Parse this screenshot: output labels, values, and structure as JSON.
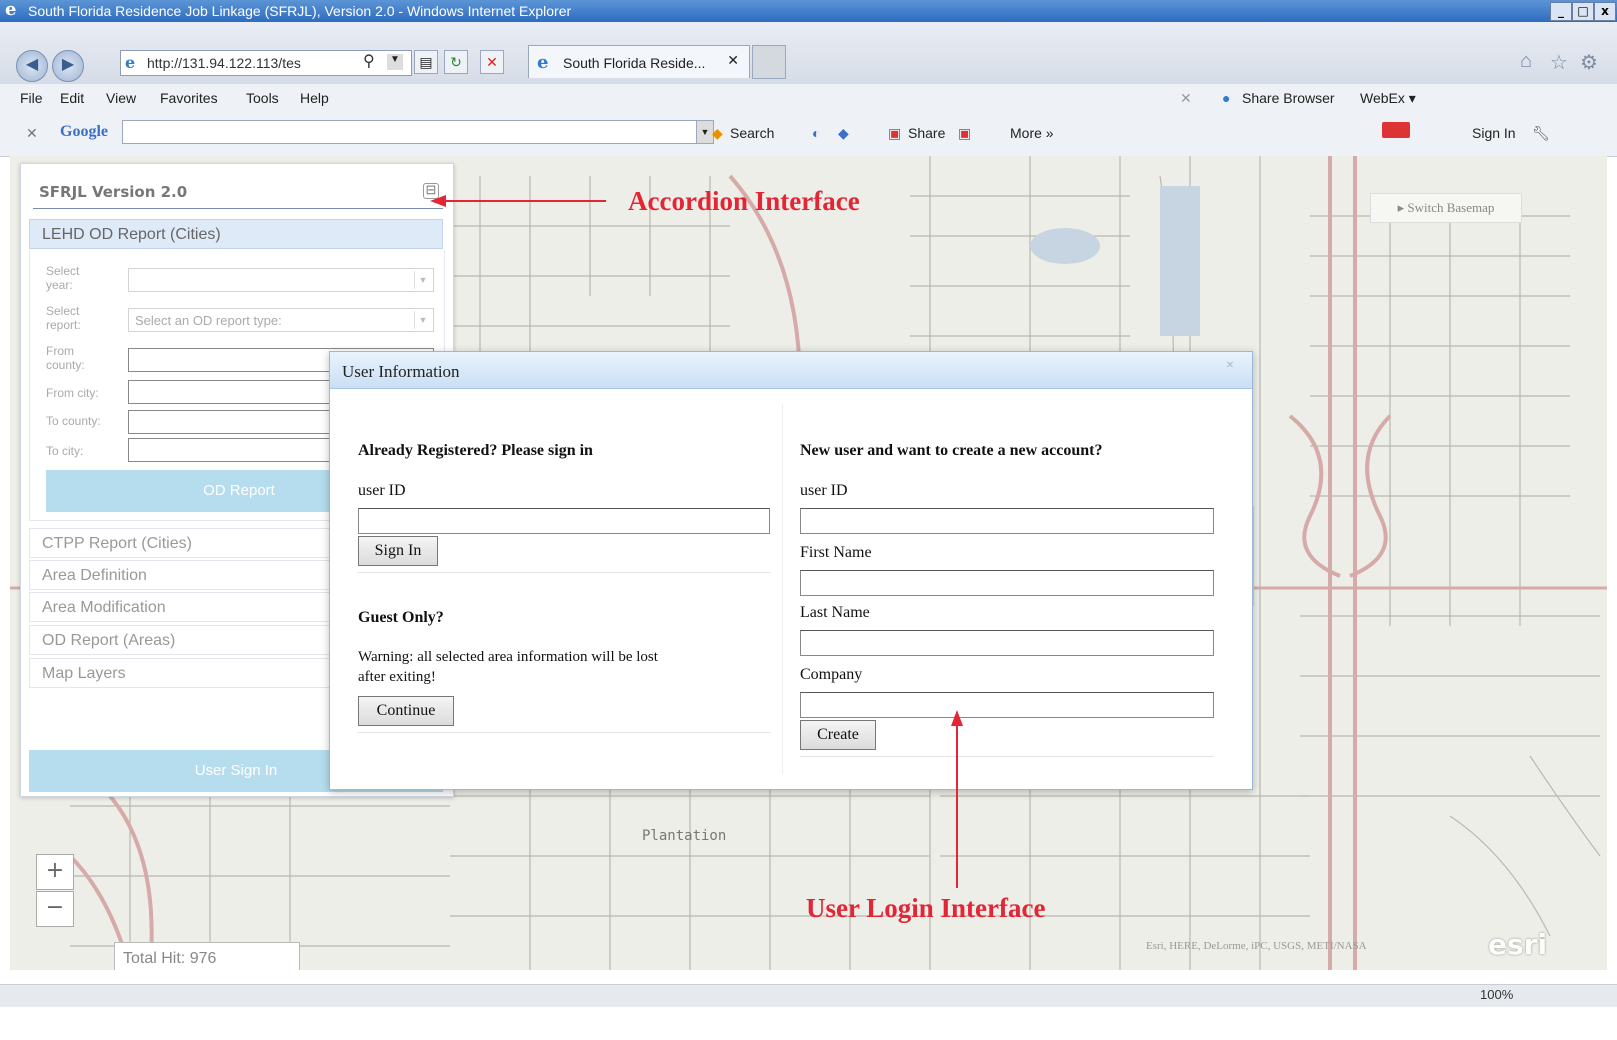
{
  "window": {
    "title": "South Florida Residence Job Linkage (SFRJL), Version 2.0 - Windows Internet Explorer",
    "minimize": "_",
    "maximize": "□",
    "close": "x"
  },
  "browser": {
    "address": "http://131.94.122.113/tes",
    "tab_title": "South Florida Reside...",
    "menu": [
      "File",
      "Edit",
      "View",
      "Favorites",
      "Tools",
      "Help"
    ],
    "share_browser": "Share Browser",
    "webex": "WebEx ▾",
    "google_logo": "Google",
    "search_label": "Search",
    "share_label": "Share",
    "more_label": "More »",
    "signin_label": "Sign In",
    "zoom_level": "100%"
  },
  "map": {
    "switch_basemap": "▸ Switch Basemap",
    "zoom_in": "+",
    "zoom_out": "−",
    "total_hit": "Total Hit: 976",
    "place_label": "Plantation",
    "attribution": "Esri, HERE, DeLorme, iPC, USGS, METI/NASA",
    "logo": "esri"
  },
  "panel": {
    "title": "SFRJL Version 2.0",
    "collapse_icon": "⊟",
    "sections": [
      "LEHD OD Report (Cities)",
      "CTPP Report (Cities)",
      "Area Definition",
      "Area Modification",
      "OD Report (Areas)",
      "Map Layers"
    ],
    "form": {
      "select_year_label": "Select year:",
      "select_report_label": "Select report:",
      "report_placeholder": "Select an OD report type:",
      "from_county_label": "From county:",
      "from_city_label": "From city:",
      "to_county_label": "To county:",
      "to_city_label": "To city:",
      "od_report_button": "OD Report"
    },
    "user_signin_button": "User Sign In"
  },
  "dialog": {
    "title": "User Information",
    "close": "×",
    "signin": {
      "heading": "Already Registered? Please sign in",
      "user_id_label": "user ID",
      "button": "Sign In"
    },
    "guest": {
      "heading": "Guest Only?",
      "warning_line1": "Warning: all selected area information will be lost",
      "warning_line2": "after exiting!",
      "button": "Continue"
    },
    "register": {
      "heading": "New user and want to create a new account?",
      "user_id_label": "user ID",
      "first_name_label": "First Name",
      "last_name_label": "Last Name",
      "company_label": "Company",
      "button": "Create"
    }
  },
  "annotations": {
    "accordion": "Accordion Interface",
    "login": "User Login Interface",
    "color": "#e32636"
  }
}
